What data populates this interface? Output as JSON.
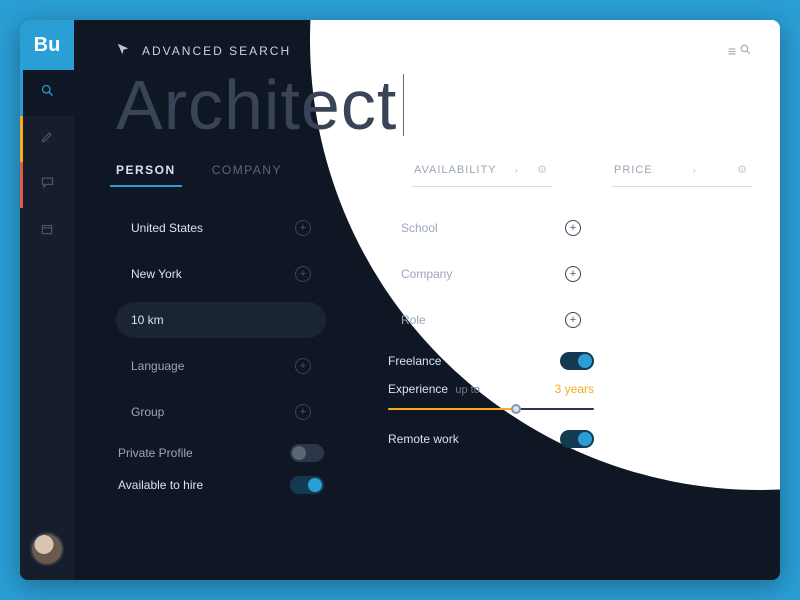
{
  "logo_text": "Bu",
  "header": {
    "title": "ADVANCED SEARCH"
  },
  "search_value": "Architect",
  "tabs": {
    "person": "PERSON",
    "company": "COMPANY"
  },
  "chips": {
    "availability": "AVAILABILITY",
    "price": "PRICE"
  },
  "left_col": {
    "country": "United States",
    "city": "New York",
    "radius": "10 km",
    "language": "Language",
    "group": "Group",
    "private": "Private Profile",
    "available": "Available to hire"
  },
  "right_col": {
    "school": "School",
    "company": "Company",
    "role": "Role",
    "freelance": "Freelance",
    "experience_label": "Experience",
    "experience_upto": "up to",
    "experience_value": "3 years",
    "remote": "Remote work"
  },
  "toggles": {
    "private": false,
    "available": true,
    "freelance": true,
    "remote": true
  }
}
